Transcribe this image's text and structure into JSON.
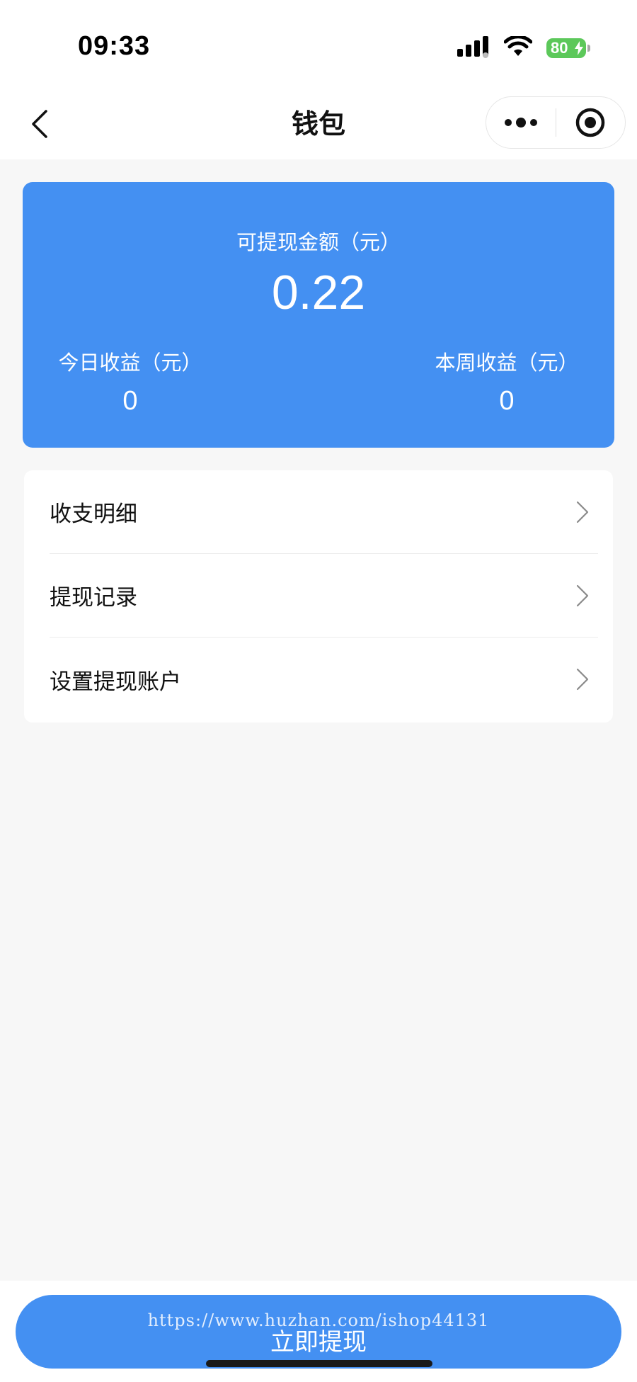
{
  "status_bar": {
    "time": "09:33",
    "battery_level": "80",
    "icons": [
      "signal-icon",
      "wifi-icon",
      "battery-icon"
    ]
  },
  "nav": {
    "title": "钱包",
    "icons": [
      "back-chevron-icon",
      "more-dots-icon",
      "record-target-icon"
    ]
  },
  "wallet": {
    "withdrawable_label": "可提现金额（元）",
    "withdrawable_amount": "0.22",
    "today_label": "今日收益（元）",
    "today_value": "0",
    "week_label": "本周收益（元）",
    "week_value": "0"
  },
  "menu": {
    "items": [
      {
        "label": "收支明细"
      },
      {
        "label": "提现记录"
      },
      {
        "label": "设置提现账户"
      }
    ]
  },
  "footer": {
    "withdraw_button": "立即提现",
    "watermark": "https://www.huzhan.com/ishop44131"
  },
  "colors": {
    "accent": "#4490f2",
    "background": "#f7f7f7",
    "battery": "#5cc85a"
  }
}
